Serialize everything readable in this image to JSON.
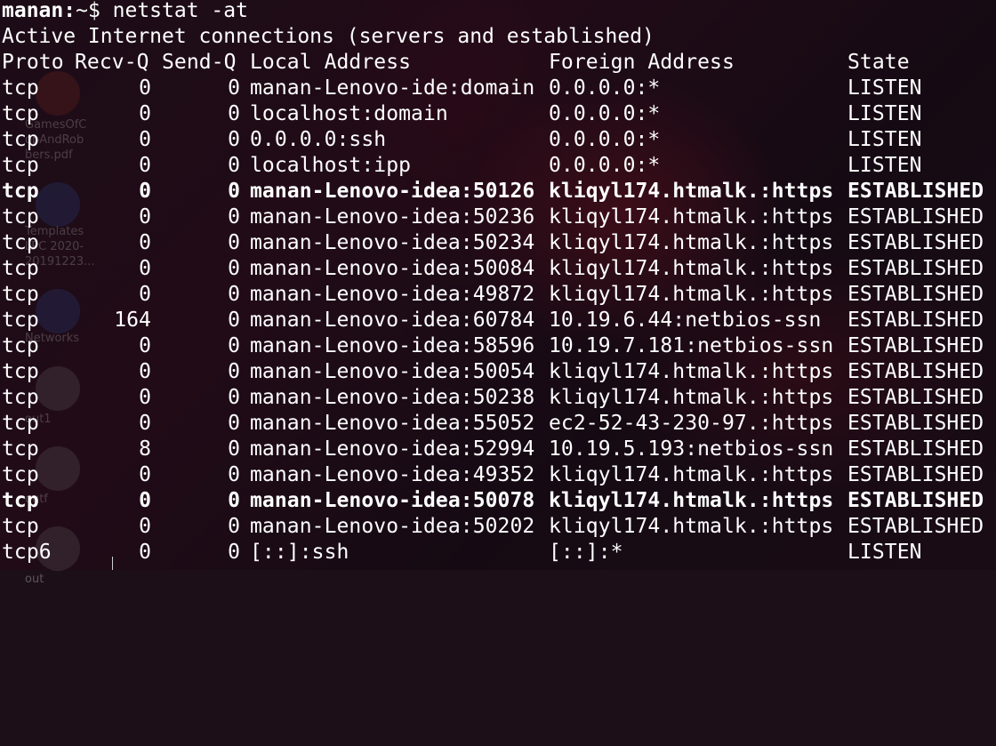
{
  "desktop": {
    "labels": [
      {
        "text": "GamesOfC\nopAndRob\nbers.pdf"
      },
      {
        "text": "Templates\nLPC 2020-\n20191223..."
      },
      {
        "text": "Networks"
      },
      {
        "text": "out1"
      },
      {
        "text": "outf"
      },
      {
        "text": "out"
      }
    ]
  },
  "terminal": {
    "prompt_user": "manan:",
    "prompt_path": "~$ ",
    "command": "netstat -at",
    "heading": "Active Internet connections (servers and established)",
    "columns": {
      "proto": "Proto",
      "recvq": "Recv-Q",
      "sendq": "Send-Q",
      "local": "Local Address",
      "foreign": "Foreign Address",
      "state": "State"
    },
    "rows": [
      {
        "proto": "tcp",
        "recvq": "0",
        "sendq": "0",
        "local": "manan-Lenovo-ide:domain",
        "foreign": "0.0.0.0:*",
        "state": "LISTEN"
      },
      {
        "proto": "tcp",
        "recvq": "0",
        "sendq": "0",
        "local": "localhost:domain",
        "foreign": "0.0.0.0:*",
        "state": "LISTEN"
      },
      {
        "proto": "tcp",
        "recvq": "0",
        "sendq": "0",
        "local": "0.0.0.0:ssh",
        "foreign": "0.0.0.0:*",
        "state": "LISTEN"
      },
      {
        "proto": "tcp",
        "recvq": "0",
        "sendq": "0",
        "local": "localhost:ipp",
        "foreign": "0.0.0.0:*",
        "state": "LISTEN"
      },
      {
        "proto": "tcp",
        "recvq": "0",
        "sendq": "0",
        "local": "manan-Lenovo-idea:50126",
        "foreign": "kliqyl174.htmalk.:https",
        "state": "ESTABLISHED"
      },
      {
        "proto": "tcp",
        "recvq": "0",
        "sendq": "0",
        "local": "manan-Lenovo-idea:50236",
        "foreign": "kliqyl174.htmalk.:https",
        "state": "ESTABLISHED"
      },
      {
        "proto": "tcp",
        "recvq": "0",
        "sendq": "0",
        "local": "manan-Lenovo-idea:50234",
        "foreign": "kliqyl174.htmalk.:https",
        "state": "ESTABLISHED"
      },
      {
        "proto": "tcp",
        "recvq": "0",
        "sendq": "0",
        "local": "manan-Lenovo-idea:50084",
        "foreign": "kliqyl174.htmalk.:https",
        "state": "ESTABLISHED"
      },
      {
        "proto": "tcp",
        "recvq": "0",
        "sendq": "0",
        "local": "manan-Lenovo-idea:49872",
        "foreign": "kliqyl174.htmalk.:https",
        "state": "ESTABLISHED"
      },
      {
        "proto": "tcp",
        "recvq": "164",
        "sendq": "0",
        "local": "manan-Lenovo-idea:60784",
        "foreign": "10.19.6.44:netbios-ssn",
        "state": "ESTABLISHED"
      },
      {
        "proto": "tcp",
        "recvq": "0",
        "sendq": "0",
        "local": "manan-Lenovo-idea:58596",
        "foreign": "10.19.7.181:netbios-ssn",
        "state": "ESTABLISHED"
      },
      {
        "proto": "tcp",
        "recvq": "0",
        "sendq": "0",
        "local": "manan-Lenovo-idea:50054",
        "foreign": "kliqyl174.htmalk.:https",
        "state": "ESTABLISHED"
      },
      {
        "proto": "tcp",
        "recvq": "0",
        "sendq": "0",
        "local": "manan-Lenovo-idea:50238",
        "foreign": "kliqyl174.htmalk.:https",
        "state": "ESTABLISHED"
      },
      {
        "proto": "tcp",
        "recvq": "0",
        "sendq": "0",
        "local": "manan-Lenovo-idea:55052",
        "foreign": "ec2-52-43-230-97.:https",
        "state": "ESTABLISHED"
      },
      {
        "proto": "tcp",
        "recvq": "8",
        "sendq": "0",
        "local": "manan-Lenovo-idea:52994",
        "foreign": "10.19.5.193:netbios-ssn",
        "state": "ESTABLISHED"
      },
      {
        "proto": "tcp",
        "recvq": "0",
        "sendq": "0",
        "local": "manan-Lenovo-idea:49352",
        "foreign": "kliqyl174.htmalk.:https",
        "state": "ESTABLISHED"
      },
      {
        "proto": "tcp",
        "recvq": "0",
        "sendq": "0",
        "local": "manan-Lenovo-idea:50078",
        "foreign": "kliqyl174.htmalk.:https",
        "state": "ESTABLISHED"
      },
      {
        "proto": "tcp",
        "recvq": "0",
        "sendq": "0",
        "local": "manan-Lenovo-idea:50202",
        "foreign": "kliqyl174.htmalk.:https",
        "state": "ESTABLISHED"
      },
      {
        "proto": "tcp6",
        "recvq": "0",
        "sendq": "0",
        "local": "[::]:ssh",
        "foreign": "[::]:*",
        "state": "LISTEN"
      }
    ]
  }
}
